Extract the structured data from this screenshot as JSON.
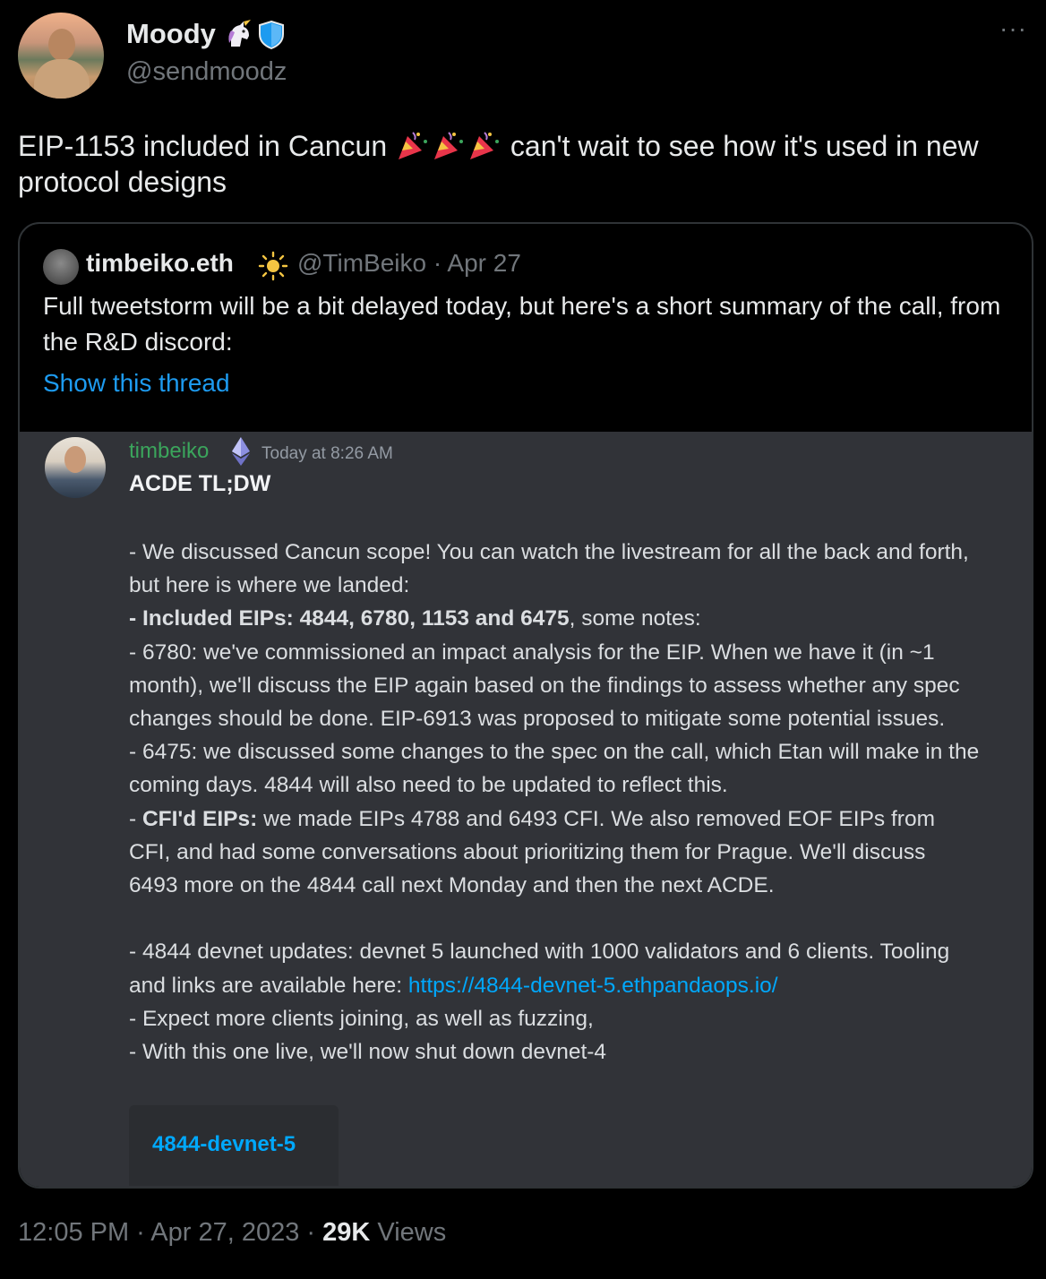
{
  "author": {
    "name": "Moody",
    "handle": "@sendmoodz"
  },
  "tweet": {
    "text_before": "EIP-1153 included in Cancun",
    "text_after": "can't wait to see how it's used in new protocol designs"
  },
  "quote": {
    "name": "timbeiko.eth",
    "handle_date": "@TimBeiko · Apr 27",
    "text": "Full tweetstorm will be a bit delayed today, but here's a short summary of the call, from the R&D discord:",
    "show_thread": "Show this thread"
  },
  "discord": {
    "username": "timbeiko",
    "timestamp": "Today at 8:26 AM",
    "title": "ACDE TL;DW",
    "lines": {
      "l1": "- We discussed Cancun scope! You can watch the livestream for all the back and forth, but here is where we landed:",
      "l2_bold": "- Included EIPs: 4844, 6780, 1153 and 6475",
      "l2_rest": ", some notes:",
      "l3": "- 6780: we've commissioned an impact analysis for the EIP. When we have it (in ~1 month), we'll discuss the EIP again based on the findings to assess whether any spec changes should be done. EIP-6913 was proposed to mitigate some potential issues.",
      "l4": "- 6475: we discussed some changes to the spec on the call, which Etan will make in the coming days. 4844 will also need to be updated to reflect this.",
      "l5_prefix": "- ",
      "l5_bold": "CFI'd EIPs:",
      "l5_rest": " we made EIPs 4788 and 6493 CFI. We also removed EOF EIPs from CFI, and had some conversations about prioritizing them for Prague. We'll discuss 6493 more on the 4844 call next Monday and then the next ACDE.",
      "l6": "- 4844 devnet updates: devnet 5 launched with 1000 validators and 6 clients. Tooling and links are available here: ",
      "l6_link": "https://4844-devnet-5.ethpandaops.io/",
      "l7": "- Expect more clients joining, as well as fuzzing,",
      "l8": "- With this one live, we'll now shut down devnet-4"
    },
    "embed_title": "4844-devnet-5"
  },
  "footer": {
    "time_date": "12:05 PM · Apr 27, 2023 · ",
    "views_count": "29K",
    "views_label": " Views"
  },
  "icons": {
    "badge1": "unicorn-icon",
    "badge2": "shield-icon",
    "emoji": "party-popper-icon",
    "quote_badge": "sun-icon",
    "discord_badge": "ethereum-icon"
  },
  "colors": {
    "link": "#1d9bf0",
    "discord_bg": "#313338",
    "discord_username": "#3ba55c"
  }
}
